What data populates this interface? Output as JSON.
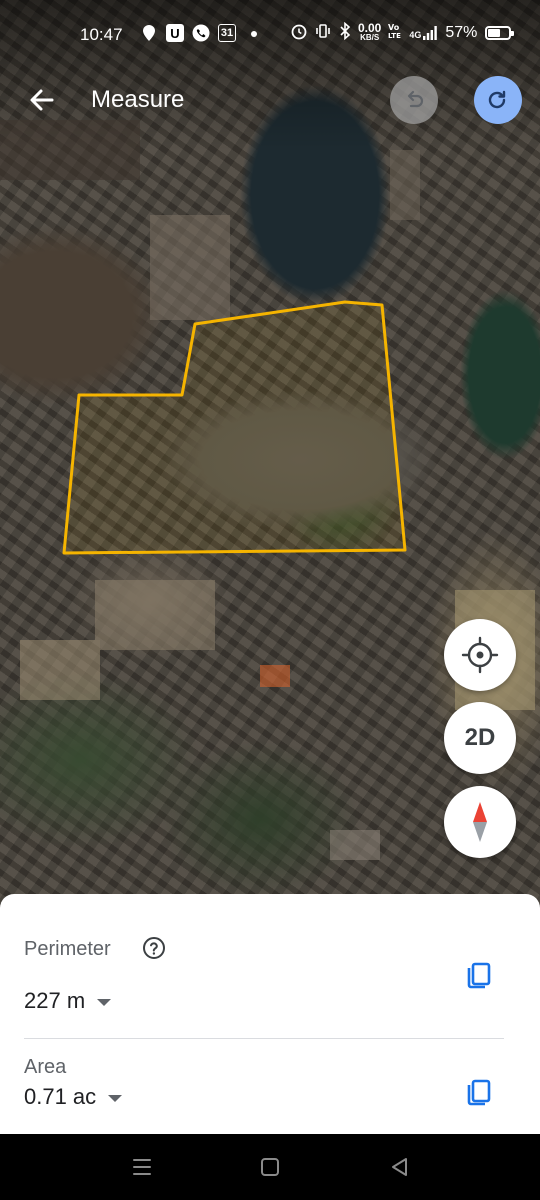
{
  "status_bar": {
    "time": "10:47",
    "calendar_day": "31",
    "net_speed_value": "0.00",
    "net_speed_unit": "KB/S",
    "network_type": "4G",
    "battery_percent": "57%"
  },
  "toolbar": {
    "title": "Measure"
  },
  "map_controls": {
    "view_mode_label": "2D"
  },
  "measurement": {
    "perimeter_label": "Perimeter",
    "perimeter_value": "227 m",
    "area_label": "Area",
    "area_value": "0.71 ac"
  },
  "colors": {
    "polygon_outline": "#f5b400",
    "redo_button": "#8ab4f8",
    "copy_icon": "#1a73e8"
  },
  "icons": {
    "back": "arrow-back-icon",
    "undo": "undo-icon",
    "redo": "redo-icon",
    "locate": "my-location-icon",
    "compass": "compass-icon",
    "help": "help-icon",
    "copy": "copy-icon"
  }
}
